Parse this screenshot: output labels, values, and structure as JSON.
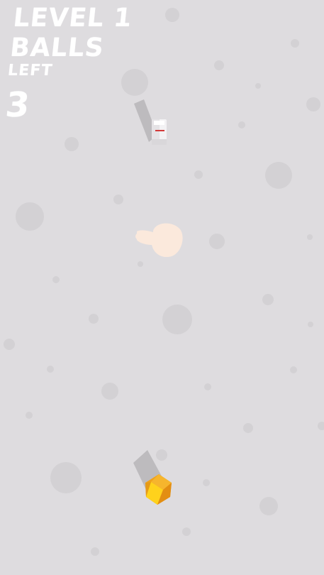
{
  "hud": {
    "level_label": "LEVEL 1",
    "balls_label": "BALLS",
    "left_label": "LEFT",
    "balls_left": "3"
  },
  "colors": {
    "background": "#dedcdf",
    "crater": "#d2d0d3",
    "shadow": "#bdbbbe",
    "ball_orange": "#f0a21a",
    "ball_yellow": "#ffd21c",
    "pin_white": "#f1f0f2",
    "pin_stripe": "#d33a3a",
    "hand": "#fbe9dc"
  },
  "icons": {
    "hint": "swipe-hand-icon",
    "target": "bowling-pin-icon",
    "ball": "ball-icon"
  }
}
